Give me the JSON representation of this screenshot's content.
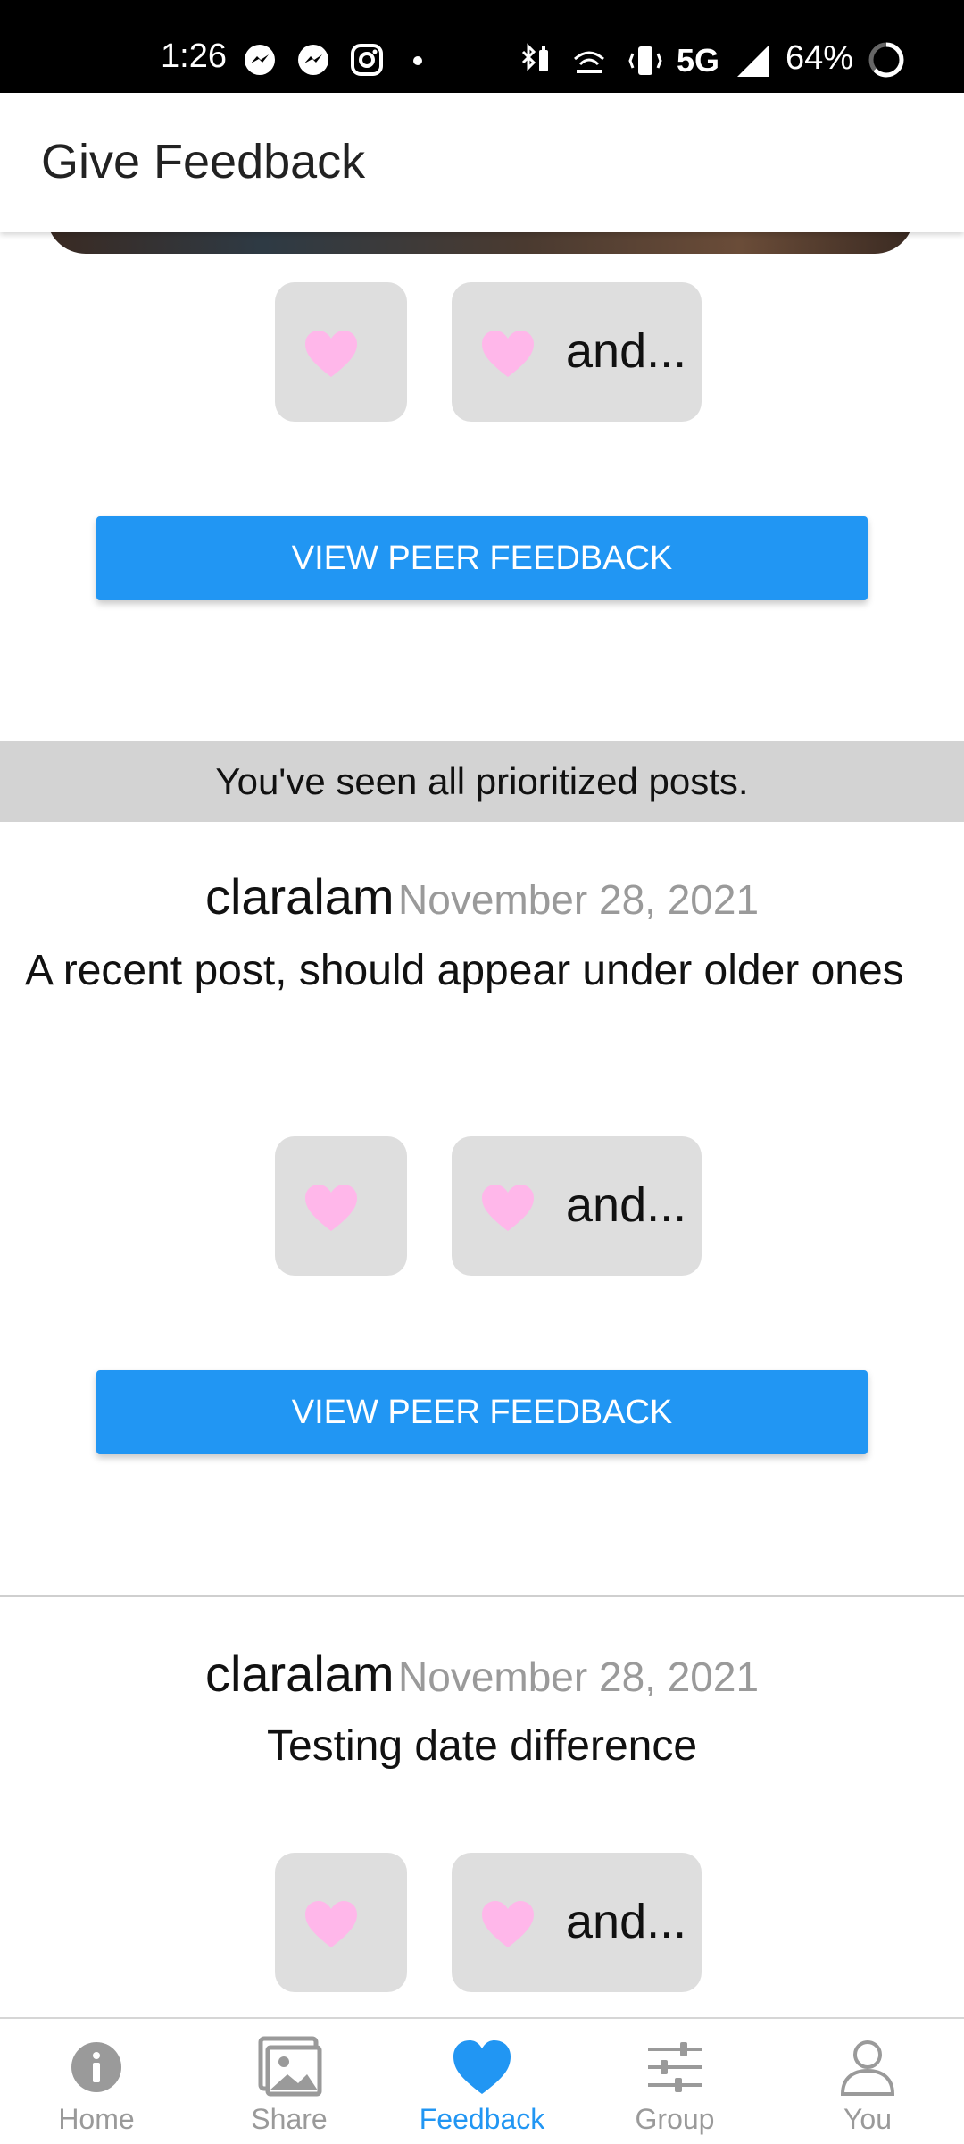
{
  "status_bar": {
    "time": "1:26",
    "network": "5G",
    "battery": "64%"
  },
  "header": {
    "title": "Give Feedback"
  },
  "reactions": {
    "more_label": "and..."
  },
  "view_peer_label": "VIEW PEER FEEDBACK",
  "banner": "You've seen all prioritized posts.",
  "posts": [
    {
      "author": "claralam",
      "date": "November 28, 2021",
      "text": "A recent post, should appear under older ones"
    },
    {
      "author": "claralam",
      "date": "November 28, 2021",
      "text": "Testing date difference"
    }
  ],
  "bottom_nav": [
    {
      "label": "Home",
      "icon": "info-circle-icon"
    },
    {
      "label": "Share",
      "icon": "image-icon"
    },
    {
      "label": "Feedback",
      "icon": "heart-icon"
    },
    {
      "label": "Group",
      "icon": "sliders-icon"
    },
    {
      "label": "You",
      "icon": "person-icon"
    }
  ],
  "colors": {
    "accent": "#2196f3",
    "heart": "#ffb7ea",
    "reaction_bg": "#dedede",
    "banner_bg": "#d3d3d3",
    "nav_inactive": "#9a9a9a"
  }
}
